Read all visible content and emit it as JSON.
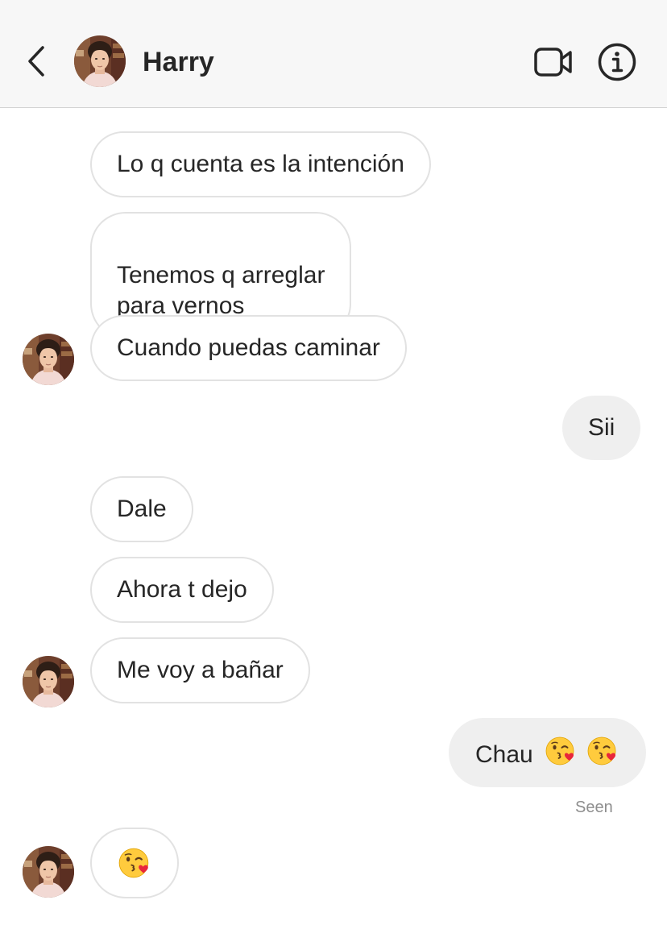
{
  "header": {
    "contact_name": "Harry",
    "back_icon": "chevron-left-icon",
    "video_icon": "video-camera-icon",
    "info_icon": "info-icon"
  },
  "messages": [
    {
      "sender": "contact",
      "text": "Lo q cuenta es la intención"
    },
    {
      "sender": "contact",
      "text": "Tenemos q arreglar\npara vernos"
    },
    {
      "sender": "contact",
      "text": "Cuando puedas caminar"
    },
    {
      "sender": "me",
      "text": "Sii"
    },
    {
      "sender": "contact",
      "text": "Dale"
    },
    {
      "sender": "contact",
      "text": "Ahora t dejo"
    },
    {
      "sender": "contact",
      "text": "Me voy a bañar"
    },
    {
      "sender": "me",
      "text": "Chau",
      "emojis": [
        "kissing-heart-emoji",
        "kissing-heart-emoji"
      ]
    },
    {
      "sender": "contact",
      "text": "",
      "emojis": [
        "kissing-heart-emoji"
      ]
    }
  ],
  "status": {
    "seen": "Seen"
  },
  "colors": {
    "header_bg": "#f7f7f7",
    "incoming_border": "#e2e2e2",
    "outgoing_bg": "#efefef",
    "text": "#262626",
    "seen_text": "#8e8e8e",
    "emoji_face": "#ffcb3d",
    "emoji_heart": "#e8263b"
  }
}
